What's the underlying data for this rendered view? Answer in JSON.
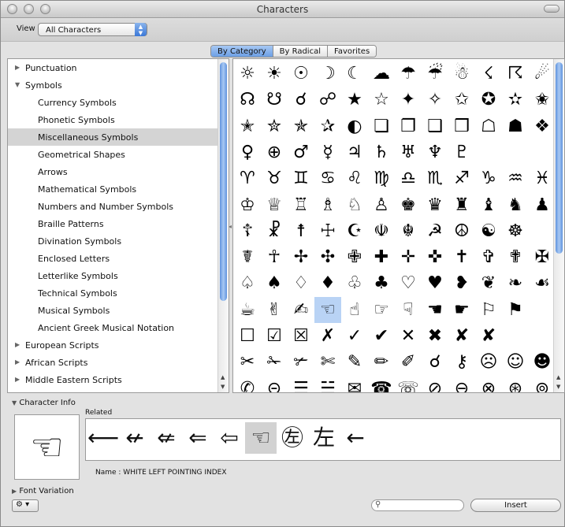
{
  "window": {
    "title": "Characters"
  },
  "toolbar": {
    "view_label": "View :",
    "view_value": "All Characters"
  },
  "tabs": [
    {
      "label": "By Category"
    },
    {
      "label": "By Radical"
    },
    {
      "label": "Favorites"
    }
  ],
  "category_list": [
    {
      "label": "Punctuation",
      "disclosure": "▶"
    },
    {
      "label": "Symbols",
      "disclosure": "▼"
    },
    {
      "label": "Currency Symbols",
      "disclosure": ""
    },
    {
      "label": "Phonetic Symbols",
      "disclosure": ""
    },
    {
      "label": "Miscellaneous Symbols",
      "disclosure": ""
    },
    {
      "label": "Geometrical Shapes",
      "disclosure": ""
    },
    {
      "label": "Arrows",
      "disclosure": ""
    },
    {
      "label": "Mathematical Symbols",
      "disclosure": ""
    },
    {
      "label": "Numbers and Number Symbols",
      "disclosure": ""
    },
    {
      "label": "Braille Patterns",
      "disclosure": ""
    },
    {
      "label": "Divination Symbols",
      "disclosure": ""
    },
    {
      "label": "Enclosed Letters",
      "disclosure": ""
    },
    {
      "label": "Letterlike Symbols",
      "disclosure": ""
    },
    {
      "label": "Technical Symbols",
      "disclosure": ""
    },
    {
      "label": "Musical Symbols",
      "disclosure": ""
    },
    {
      "label": "Ancient Greek Musical Notation",
      "disclosure": ""
    },
    {
      "label": "European Scripts",
      "disclosure": "▶"
    },
    {
      "label": "African Scripts",
      "disclosure": "▶"
    },
    {
      "label": "Middle Eastern Scripts",
      "disclosure": "▶"
    }
  ],
  "character_grid": [
    [
      "☼",
      "☀",
      "☉",
      "☽",
      "☾",
      "☁",
      "☂",
      "☔",
      "☃",
      "☇",
      "☈",
      "☄"
    ],
    [
      "☊",
      "☋",
      "☌",
      "☍",
      "★",
      "☆",
      "✦",
      "✧",
      "✩",
      "✪",
      "✫",
      "✬"
    ],
    [
      "✭",
      "✮",
      "✯",
      "✰",
      "◐",
      "❏",
      "❐",
      "❑",
      "❒",
      "☖",
      "☗",
      "❖"
    ],
    [
      "♀",
      "⊕",
      "♂",
      "☿",
      "♃",
      "♄",
      "♅",
      "♆",
      "♇",
      "",
      "",
      ""
    ],
    [
      "♈",
      "♉",
      "♊",
      "♋",
      "♌",
      "♍",
      "♎",
      "♏",
      "♐",
      "♑",
      "♒",
      "♓"
    ],
    [
      "♔",
      "♕",
      "♖",
      "♗",
      "♘",
      "♙",
      "♚",
      "♛",
      "♜",
      "♝",
      "♞",
      "♟"
    ],
    [
      "☦",
      "☧",
      "☨",
      "☩",
      "☪",
      "☫",
      "☬",
      "☭",
      "☮",
      "☯",
      "☸",
      ""
    ],
    [
      "☤",
      "☥",
      "✢",
      "✣",
      "✙",
      "✚",
      "✛",
      "✜",
      "✝",
      "✞",
      "✟",
      "✠"
    ],
    [
      "♤",
      "♠",
      "♢",
      "♦",
      "♧",
      "♣",
      "♡",
      "♥",
      "❥",
      "❦",
      "❧",
      "☙"
    ],
    [
      "☕",
      "✌",
      "✍",
      "☜",
      "☝",
      "☞",
      "☟",
      "☚",
      "☛",
      "⚐",
      "⚑",
      ""
    ],
    [
      "☐",
      "☑",
      "☒",
      "✗",
      "✓",
      "✔",
      "✕",
      "✖",
      "✘",
      "✘",
      "",
      ""
    ],
    [
      "✂",
      "✁",
      "✃",
      "✄",
      "✎",
      "✏",
      "✐",
      "☌",
      "⚷",
      "☹",
      "☺",
      "☻"
    ],
    [
      "✆",
      "⊝",
      "☰",
      "☱",
      "✉",
      "☎",
      "☏",
      "⊘",
      "⊖",
      "⊗",
      "⊛",
      "⊚"
    ]
  ],
  "info": {
    "header": "Character Info",
    "preview": "☜",
    "related_label": "Related",
    "related": [
      "⟵",
      "↚",
      "⇍",
      "⇐",
      "⇦",
      "☜",
      "㊧",
      "左",
      "←"
    ],
    "name_text": "Name : WHITE LEFT POINTING INDEX"
  },
  "font_variation": {
    "header": "Font Variation"
  },
  "bottom": {
    "gear": "⚙",
    "gear_arrow": "▾",
    "search_icon": "⚲",
    "insert_label": "Insert"
  }
}
